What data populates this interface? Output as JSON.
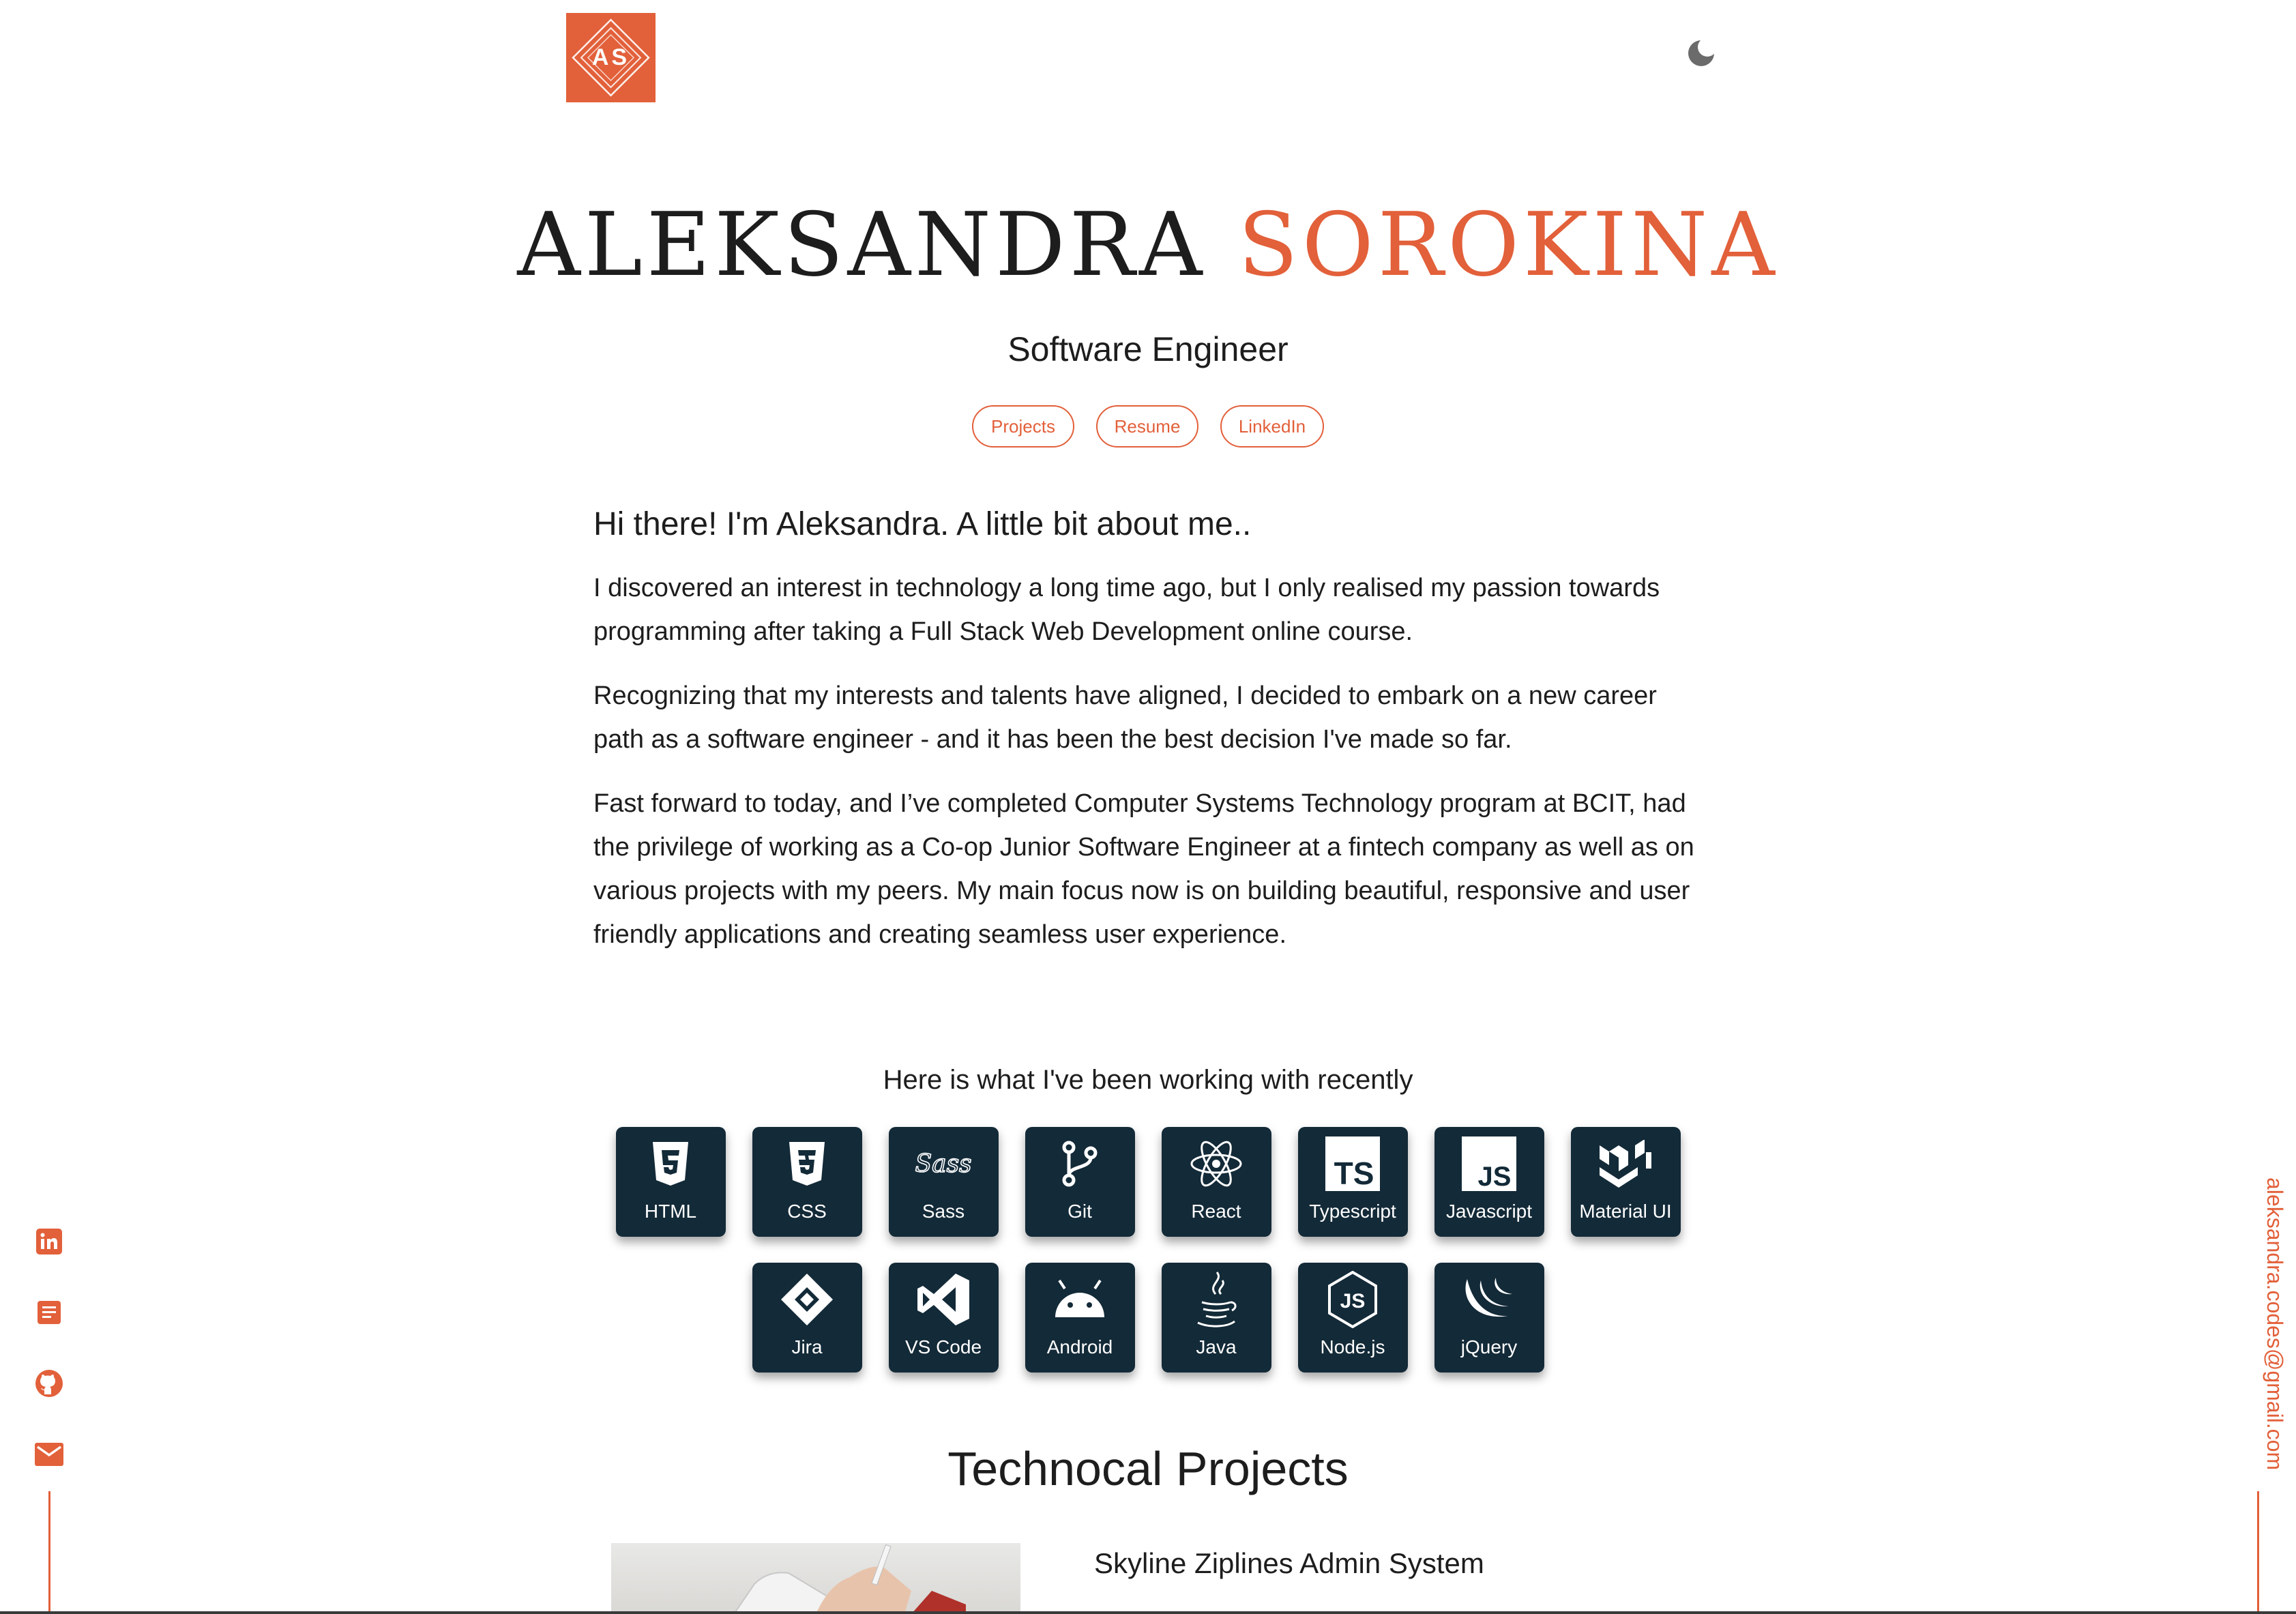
{
  "header": {
    "logo_text": "AS",
    "theme_toggle_icon": "moon-icon"
  },
  "hero": {
    "first_name": "ALEKSANDRA",
    "last_name": "SOROKINA",
    "subtitle": "Software Engineer",
    "buttons": [
      {
        "label": "Projects"
      },
      {
        "label": "Resume"
      },
      {
        "label": "LinkedIn"
      }
    ]
  },
  "about": {
    "heading": "Hi there! I'm Aleksandra. A little bit about me..",
    "paragraphs": [
      "I discovered an interest in technology a long time ago, but I only realised my passion towards programming after taking a Full Stack Web Development online course.",
      "Recognizing that my interests and talents have aligned, I decided to embark on a new career path as a software engineer - and it has been the best decision I've made so far.",
      "Fast forward to today, and I’ve completed Computer Systems Technology program at BCIT, had the privilege of working as a Co-op Junior Software Engineer at a fintech company as well as on various projects with my peers. My main focus now is on building beautiful, responsive and user friendly applications and creating seamless user experience."
    ]
  },
  "skills": {
    "title": "Here is what I've been working with recently",
    "items": [
      {
        "label": "HTML",
        "icon": "html5-icon"
      },
      {
        "label": "CSS",
        "icon": "css3-icon"
      },
      {
        "label": "Sass",
        "icon": "sass-icon"
      },
      {
        "label": "Git",
        "icon": "git-icon"
      },
      {
        "label": "React",
        "icon": "react-icon"
      },
      {
        "label": "Typescript",
        "icon": "typescript-icon"
      },
      {
        "label": "Javascript",
        "icon": "javascript-icon"
      },
      {
        "label": "Material UI",
        "icon": "material-ui-icon"
      },
      {
        "label": "Jira",
        "icon": "jira-icon"
      },
      {
        "label": "VS Code",
        "icon": "vscode-icon"
      },
      {
        "label": "Android",
        "icon": "android-icon"
      },
      {
        "label": "Java",
        "icon": "java-icon"
      },
      {
        "label": "Node.js",
        "icon": "nodejs-icon"
      },
      {
        "label": "jQuery",
        "icon": "jquery-icon"
      }
    ]
  },
  "projects": {
    "title": "Technocal Projects",
    "items": [
      {
        "name": "Skyline Ziplines Admin System"
      }
    ]
  },
  "social": {
    "icons": [
      "linkedin-icon",
      "resume-icon",
      "github-icon",
      "email-icon"
    ],
    "email": "aleksandra.codes@gmail.com"
  },
  "colors": {
    "accent": "#e2603a",
    "tile": "#132a38",
    "text": "#1d1d1d"
  }
}
